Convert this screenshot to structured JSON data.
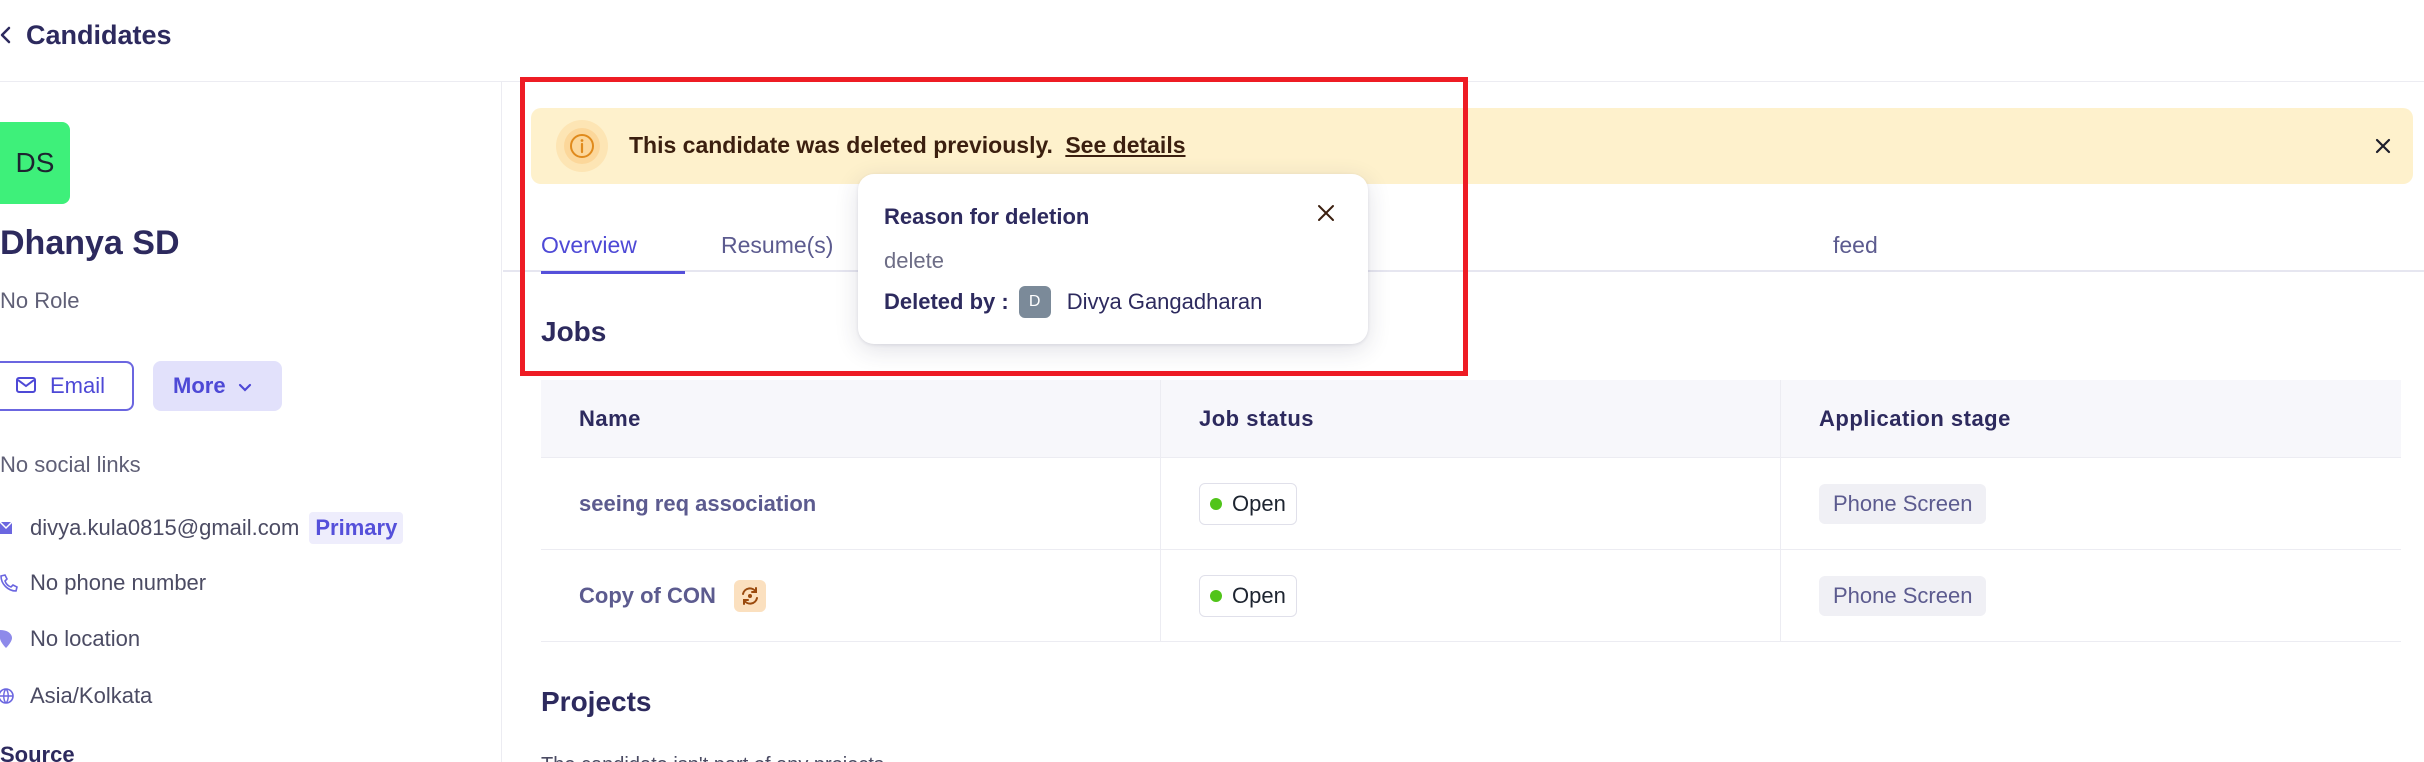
{
  "header": {
    "title": "Candidates"
  },
  "candidate": {
    "initials": "DS",
    "name": "Dhanya SD",
    "role": "No Role",
    "email_button": "Email",
    "more_button": "More",
    "social": "No social links",
    "email": "divya.kula0815@gmail.com",
    "email_badge": "Primary",
    "phone": "No phone number",
    "location": "No location",
    "timezone": "Asia/Kolkata",
    "source_heading": "Source"
  },
  "alert": {
    "text": "This candidate was deleted previously.",
    "link": "See details"
  },
  "tabs": [
    "Overview",
    "Resume(s)",
    "feed"
  ],
  "jobs": {
    "title": "Jobs",
    "columns": [
      "Name",
      "Job status",
      "Application stage"
    ],
    "rows": [
      {
        "name": "seeing req association",
        "status": "Open",
        "stage": "Phone Screen"
      },
      {
        "name": "Copy of CON",
        "status": "Open",
        "stage": "Phone Screen"
      }
    ]
  },
  "projects": {
    "title": "Projects",
    "subtitle": "The candidate isn't part of any projects"
  },
  "popover": {
    "title": "Reason for deletion",
    "reason": "delete",
    "deleted_by_label": "Deleted by :",
    "deleted_by_initial": "D",
    "deleted_by_name": "Divya Gangadharan"
  },
  "colors": {
    "accent": "#5550da",
    "alert_bg": "#fef1cc",
    "avatar_bg": "#3ef07a",
    "open_dot": "#51c41a",
    "highlight": "#ee1c24"
  }
}
